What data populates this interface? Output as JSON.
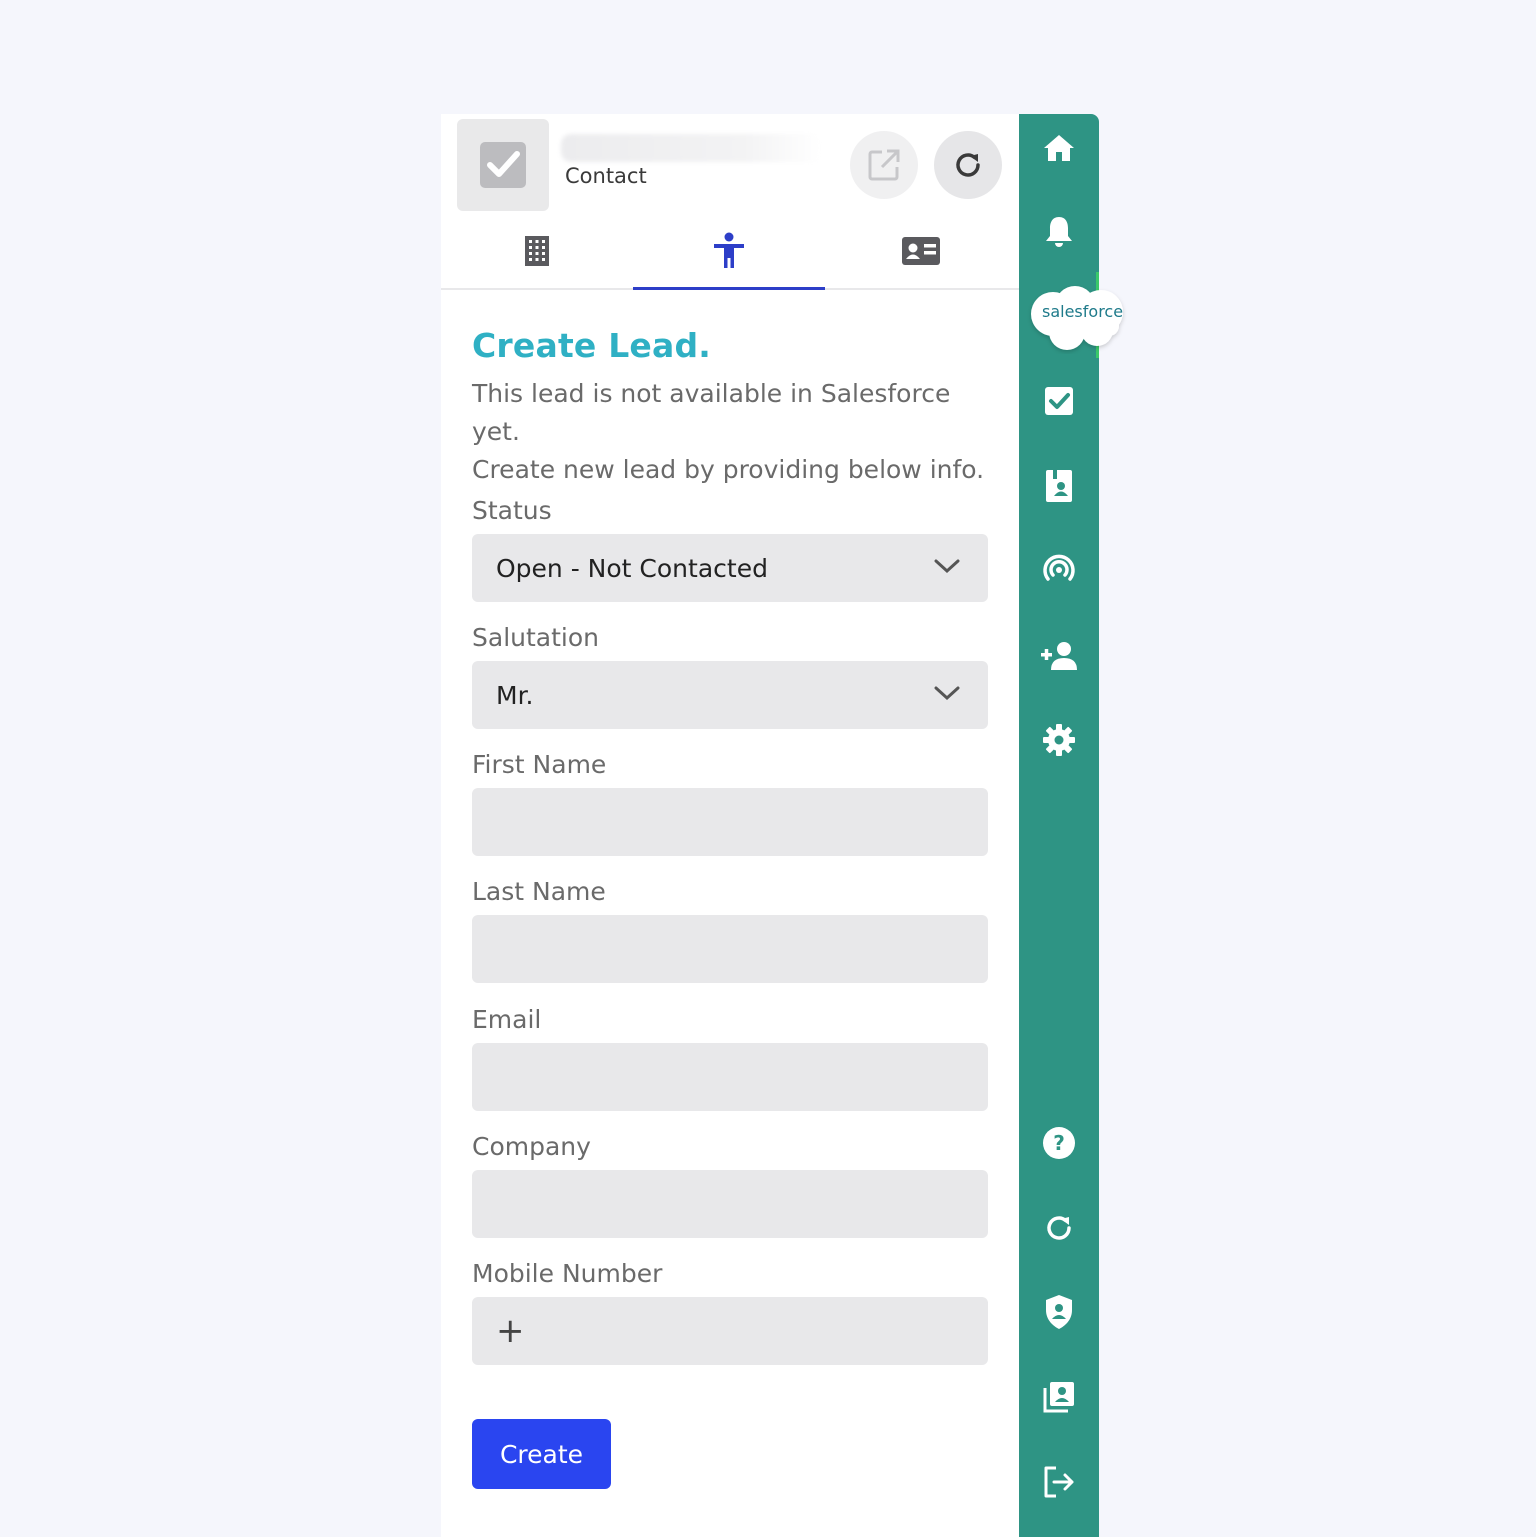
{
  "header": {
    "record_name": "",
    "record_type": "Contact",
    "buttons": [
      {
        "name": "open-external",
        "icon": "external-link-icon"
      },
      {
        "name": "refresh",
        "icon": "refresh-icon"
      }
    ]
  },
  "tabs": [
    {
      "name": "account",
      "icon": "building-icon",
      "active": false
    },
    {
      "name": "lead",
      "icon": "person-icon",
      "active": true
    },
    {
      "name": "contact",
      "icon": "contact-card-icon",
      "active": false
    }
  ],
  "form": {
    "title": "Create Lead.",
    "description_line1": "This lead is not available in Salesforce yet.",
    "description_line2": "Create new lead by providing below info.",
    "status": {
      "label": "Status",
      "value": "Open - Not Contacted"
    },
    "salutation": {
      "label": "Salutation",
      "value": "Mr."
    },
    "first_name": {
      "label": "First Name",
      "value": ""
    },
    "last_name": {
      "label": "Last Name",
      "value": ""
    },
    "email": {
      "label": "Email",
      "value": ""
    },
    "company": {
      "label": "Company",
      "value": ""
    },
    "mobile": {
      "label": "Mobile Number",
      "prefix": "+",
      "value": ""
    },
    "submit_label": "Create"
  },
  "sidebar": {
    "brand": "salesforce",
    "items_top": [
      "home-icon",
      "bell-icon",
      "salesforce-logo",
      "task-check-icon",
      "contact-book-icon",
      "broadcast-icon",
      "add-user-icon",
      "gear-icon"
    ],
    "items_bottom": [
      "help-icon",
      "sync-icon",
      "shield-user-icon",
      "address-book-icon",
      "logout-icon"
    ]
  },
  "colors": {
    "sidebar": "#2e9484",
    "title": "#2fb0c4",
    "primary_button": "#2a45f0",
    "active_tab": "#2d3ec8"
  }
}
